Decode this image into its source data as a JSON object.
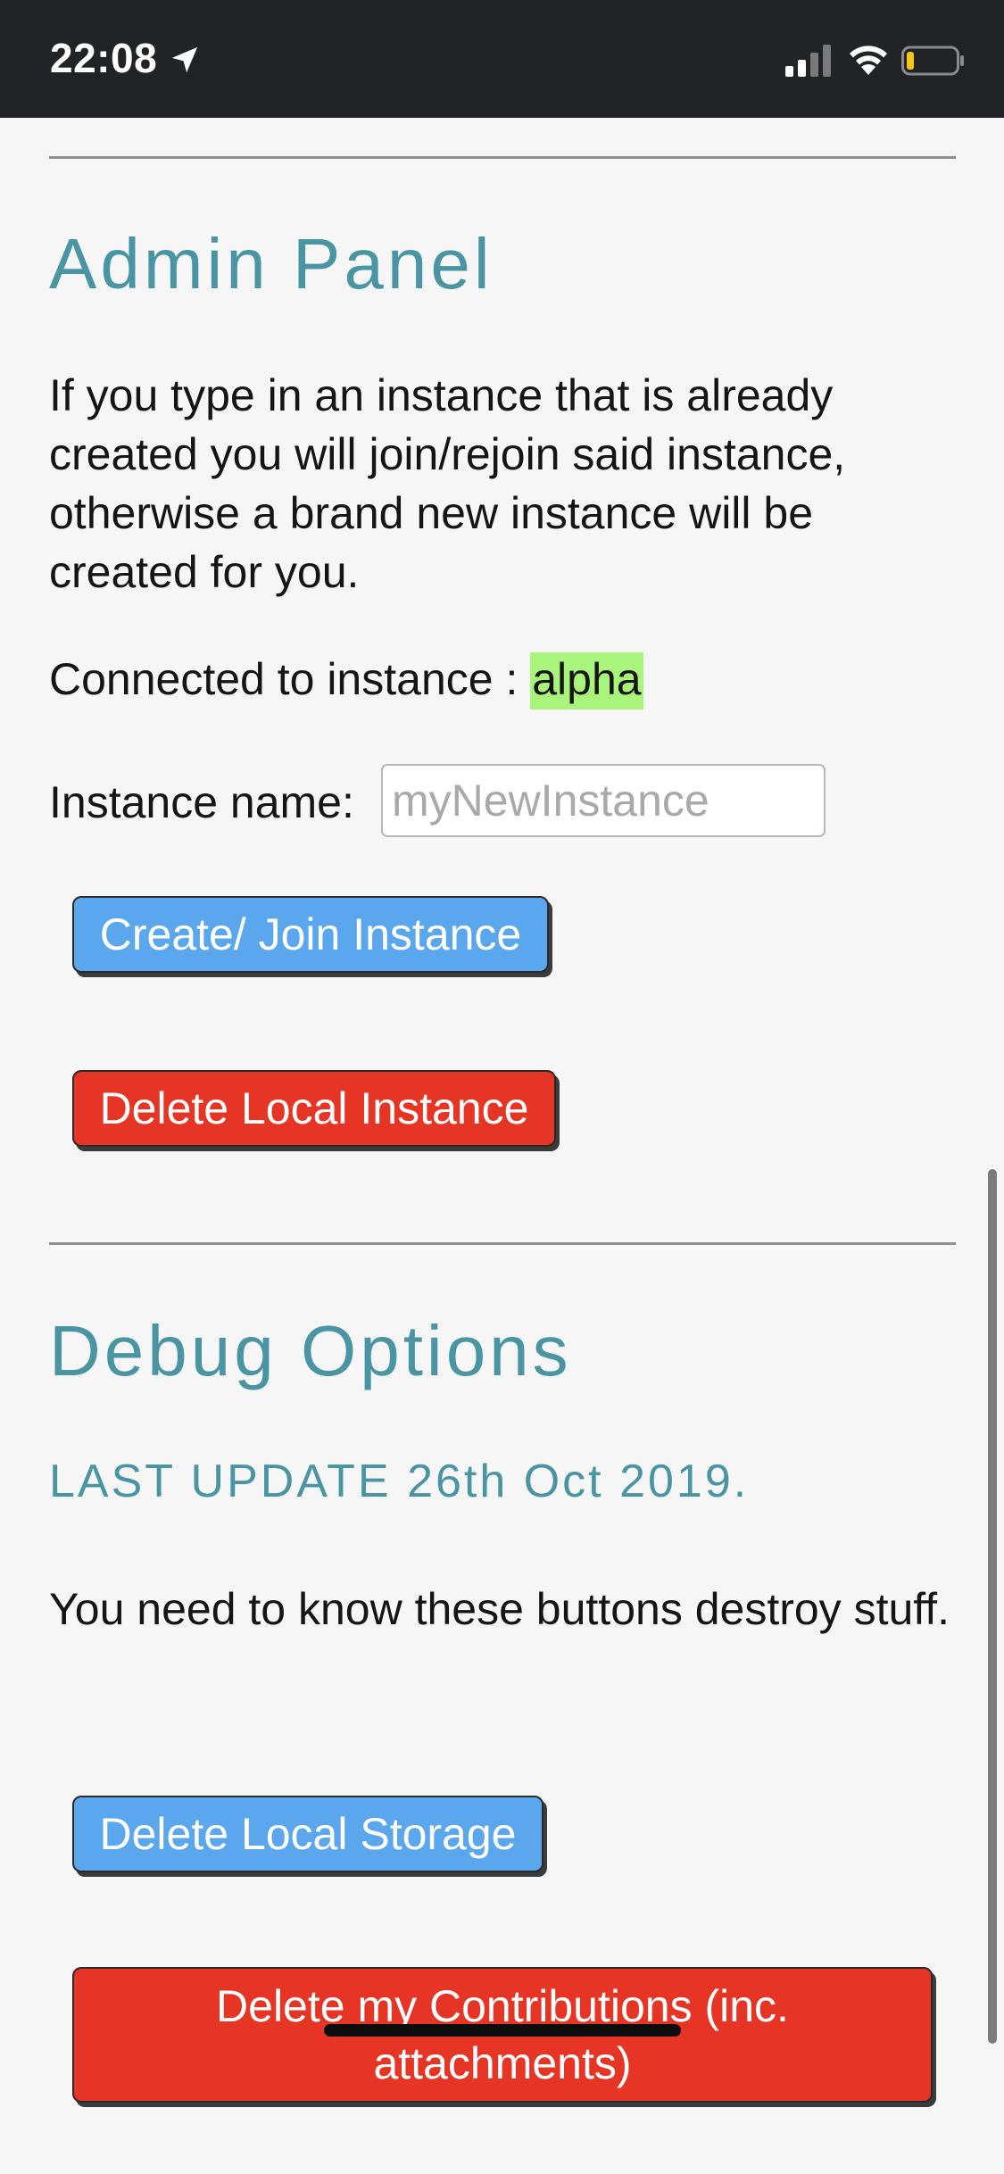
{
  "status_bar": {
    "time": "22:08",
    "location_icon": "location-arrow-icon",
    "signal_icon": "cellular-signal-icon",
    "wifi_icon": "wifi-icon",
    "battery_icon": "battery-icon",
    "battery_level": 0.15,
    "colors": {
      "background": "#222326",
      "battery_low": "#f5c518"
    }
  },
  "admin": {
    "title": "Admin Panel",
    "description": "If you type in an instance that is already created you will join/rejoin said instance, otherwise a brand new instance will be created for you.",
    "connected_label": "Connected to instance :",
    "connected_value": "alpha",
    "instance_name_label": "Instance name:",
    "instance_name_placeholder": "myNewInstance",
    "instance_name_value": "",
    "create_join_button": "Create/ Join Instance",
    "delete_local_instance_button": "Delete Local Instance"
  },
  "debug": {
    "title": "Debug Options",
    "last_update": "LAST UPDATE 26th Oct 2019.",
    "warning": "You need to know these buttons destroy stuff.",
    "delete_local_storage_button": "Delete Local Storage",
    "delete_contributions_button": "Delete my Contributions (inc. attachments)"
  },
  "colors": {
    "heading": "#4a95a4",
    "highlight": "#a9f47a",
    "button_blue": "#5aa7ee",
    "button_red": "#e63524"
  }
}
